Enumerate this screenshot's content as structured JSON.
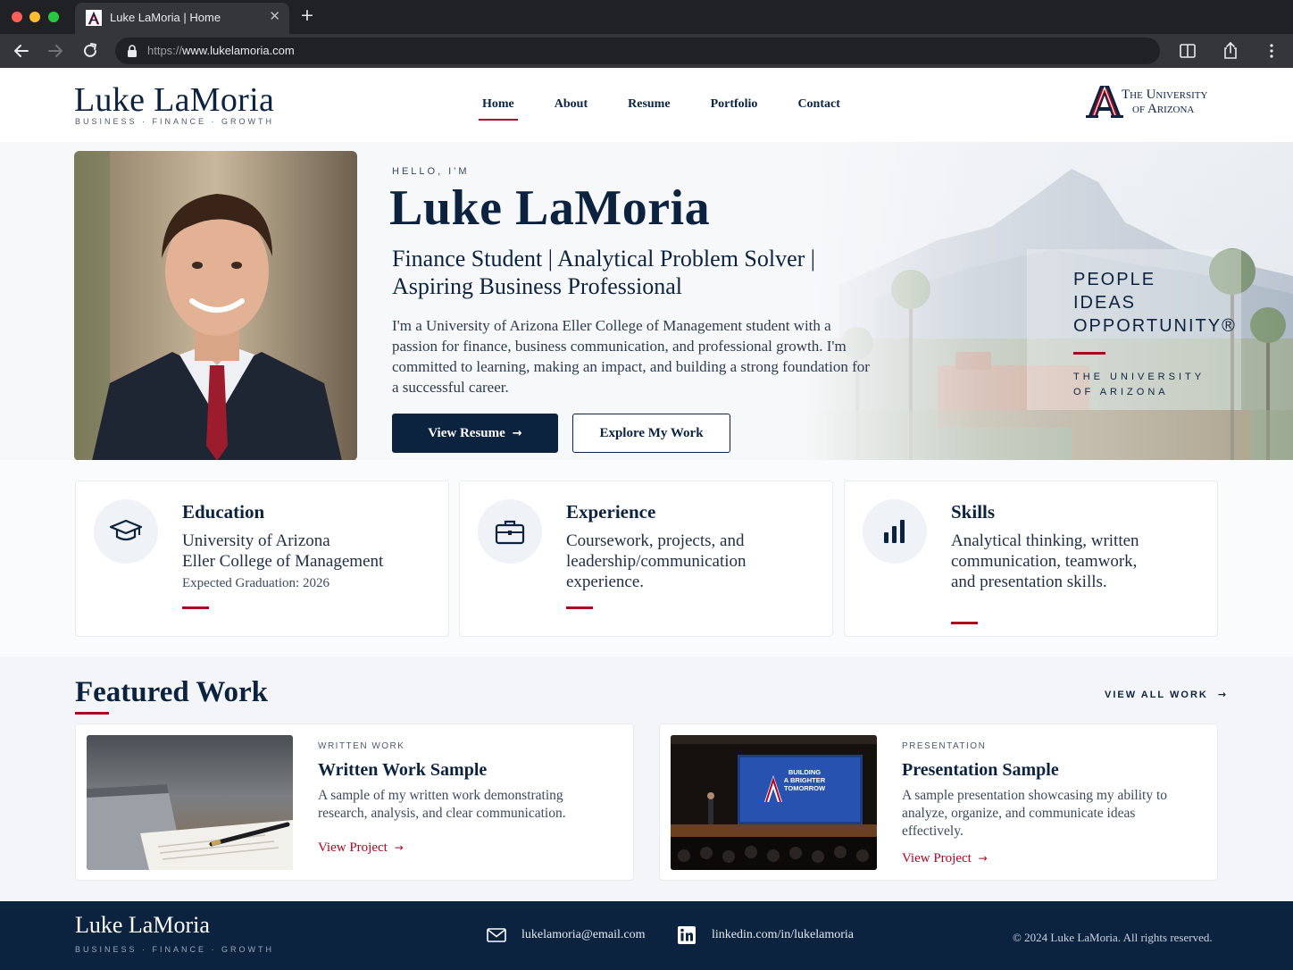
{
  "browser": {
    "tab_title": "Luke LaMoria | Home",
    "url_scheme": "https://",
    "url_host": "www.lukelamoria.com"
  },
  "header": {
    "logo_name": "Luke LaMoria",
    "logo_tagline": "BUSINESS · FINANCE · GROWTH",
    "nav": [
      {
        "label": "Home",
        "active": true
      },
      {
        "label": "About",
        "active": false
      },
      {
        "label": "Resume",
        "active": false
      },
      {
        "label": "Portfolio",
        "active": false
      },
      {
        "label": "Contact",
        "active": false
      }
    ],
    "university_line1": "The University",
    "university_line2": "of Arizona"
  },
  "hero": {
    "greeting": "HELLO, I'M",
    "name": "Luke LaMoria",
    "subtitle": "Finance Student | Analytical Problem Solver | Aspiring Business Professional",
    "description": "I'm a University of Arizona Eller College of Management student with a passion for finance, business communication, and professional growth. I'm committed to learning, making an impact, and building a strong foundation for a successful career.",
    "primary_button": "View Resume",
    "secondary_button": "Explore My Work",
    "motto": [
      "PEOPLE",
      "IDEAS",
      "OPPORTUNITY®"
    ],
    "motto_university": [
      "THE UNIVERSITY",
      "OF ARIZONA"
    ]
  },
  "cards": [
    {
      "icon": "graduation-cap-icon",
      "title": "Education",
      "body": "University of Arizona\nEller College of Management",
      "note": "Expected Graduation: 2026"
    },
    {
      "icon": "briefcase-icon",
      "title": "Experience",
      "body": "Coursework, projects, and leadership/communication experience."
    },
    {
      "icon": "bar-chart-icon",
      "title": "Skills",
      "body": "Analytical thinking, written communication, teamwork, and presentation skills."
    }
  ],
  "featured": {
    "title": "Featured Work",
    "view_all": "VIEW ALL WORK",
    "items": [
      {
        "kicker": "WRITTEN WORK",
        "title": "Written Work Sample",
        "description": "A sample of my written work demonstrating research, analysis, and clear communication.",
        "link": "View Project"
      },
      {
        "kicker": "PRESENTATION",
        "title": "Presentation Sample",
        "description": "A sample presentation showcasing my ability to analyze, organize, and communicate ideas effectively.",
        "link": "View Project",
        "slide_text": "BUILDING A BRIGHTER TOMORROW"
      }
    ]
  },
  "footer": {
    "name": "Luke LaMoria",
    "tagline": "BUSINESS · FINANCE · GROWTH",
    "email": "lukelamoria@email.com",
    "linkedin": "linkedin.com/in/lukelamoria",
    "copyright": "© 2024 Luke LaMoria. All rights reserved."
  },
  "colors": {
    "navy": "#0c2340",
    "red": "#ab0520"
  }
}
